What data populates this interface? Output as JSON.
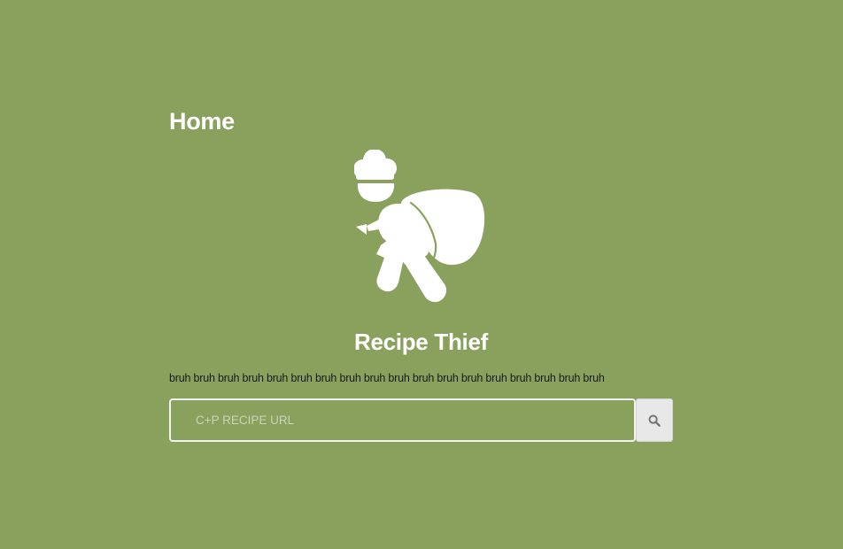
{
  "header": {
    "title": "Home"
  },
  "logo": {
    "icon": "chef-thief-icon",
    "color": "#ffffff"
  },
  "hero": {
    "app_title": "Recipe Thief",
    "tagline": "bruh bruh bruh bruh bruh bruh bruh bruh bruh bruh bruh bruh bruh bruh bruh bruh bruh bruh"
  },
  "search": {
    "value": "",
    "placeholder": "C+P RECIPE URL",
    "button_icon": "search-icon"
  },
  "colors": {
    "background": "#8aa15e",
    "text": "#ffffff",
    "button_bg": "#e8e8e8",
    "icon": "#757575"
  }
}
